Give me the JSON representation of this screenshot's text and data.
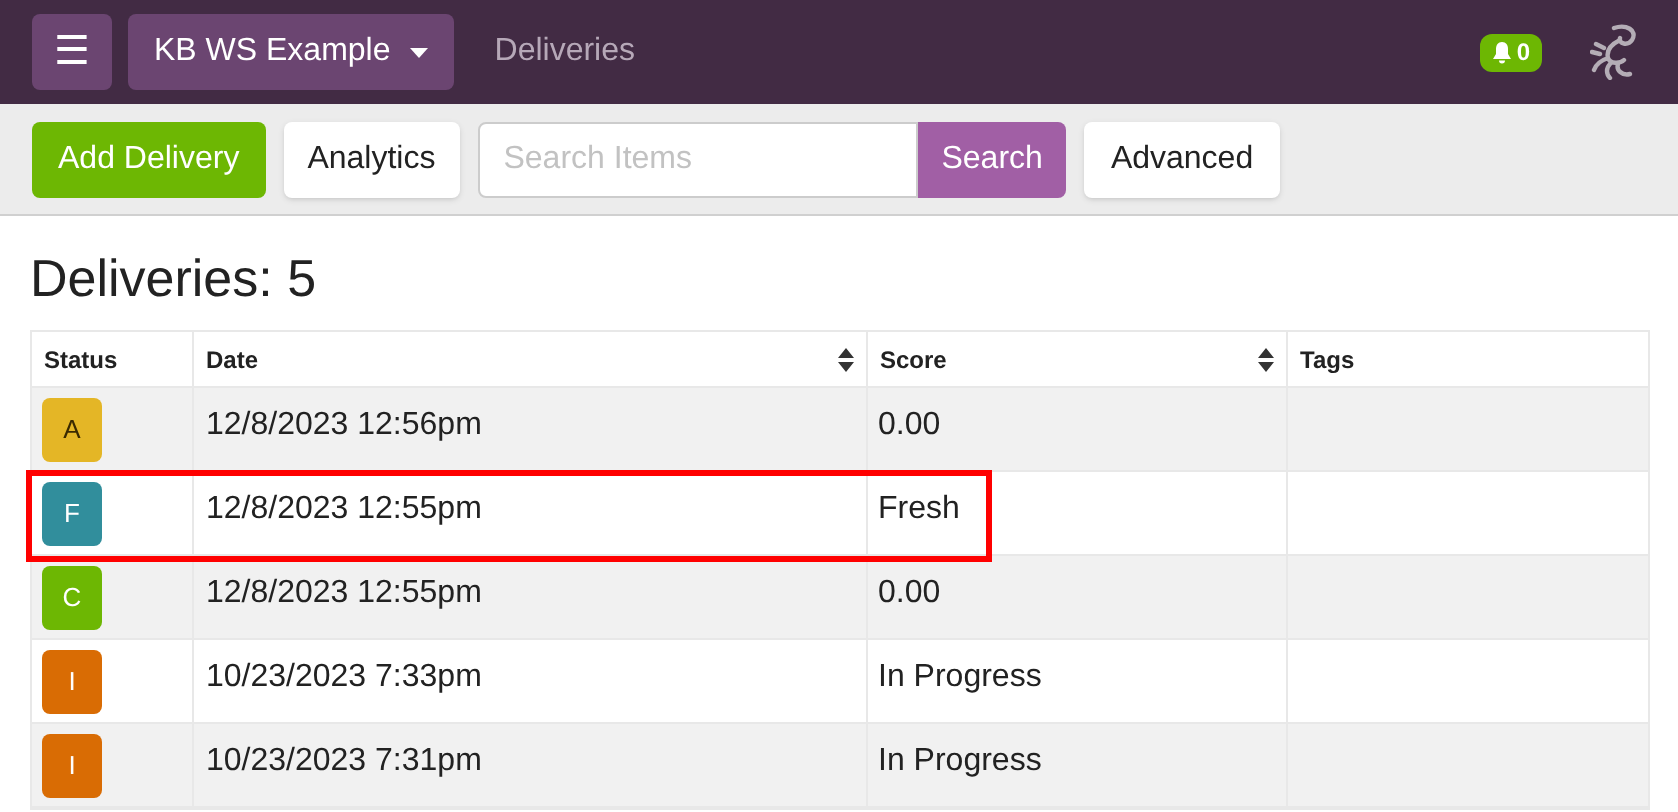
{
  "navbar": {
    "menu_button": "☰",
    "workspace": "KB WS Example",
    "page": "Deliveries",
    "notifications": "0"
  },
  "toolbar": {
    "add_button": "Add Delivery",
    "analytics_button": "Analytics",
    "search": {
      "placeholder": "Search Items"
    },
    "search_button": "Search",
    "advanced_button": "Advanced"
  },
  "heading": "Deliveries: 5",
  "table": {
    "columns": [
      {
        "label": "Status",
        "sortable": false
      },
      {
        "label": "Date",
        "sortable": true
      },
      {
        "label": "Score",
        "sortable": true
      },
      {
        "label": "Tags",
        "sortable": false
      }
    ],
    "rows": [
      {
        "status": "A",
        "color": "#e4b626",
        "date": "12/8/2023 12:56pm",
        "score": "0.00",
        "highlighted": false
      },
      {
        "status": "F",
        "color": "#318e9c",
        "date": "12/8/2023 12:55pm",
        "score": "Fresh",
        "highlighted": true
      },
      {
        "status": "C",
        "color": "#6db703",
        "date": "12/8/2023 12:55pm",
        "score": "0.00",
        "highlighted": false
      },
      {
        "status": "I",
        "color": "#d96c04",
        "date": "10/23/2023 7:33pm",
        "score": "In Progress",
        "highlighted": false
      },
      {
        "status": "I",
        "color": "#d96c04",
        "date": "10/23/2023 7:31pm",
        "score": "In Progress",
        "highlighted": false
      }
    ]
  }
}
